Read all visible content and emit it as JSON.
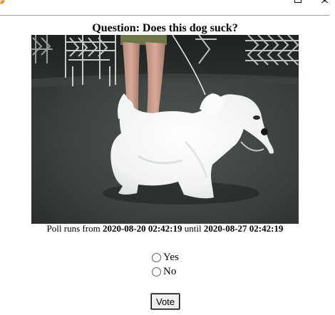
{
  "question": {
    "label": "Question: Does this dog suck?"
  },
  "photo": {
    "alt": "White Sealyham terrier dog standing on a show floor beside a handler's legs"
  },
  "poll": {
    "prefix": "Poll runs from ",
    "start": "2020-08-20 02:42:19",
    "middle": " until ",
    "end": "2020-08-27 02:42:19"
  },
  "options": [
    {
      "label": "Yes"
    },
    {
      "label": "No"
    }
  ],
  "vote_button": {
    "label": "Vote"
  },
  "colors": {
    "page_background": "#ffffff",
    "favicon": "#e08a1e"
  },
  "icons": {
    "favicon": "site-favicon-icon",
    "window_control": "window-control-icon"
  }
}
